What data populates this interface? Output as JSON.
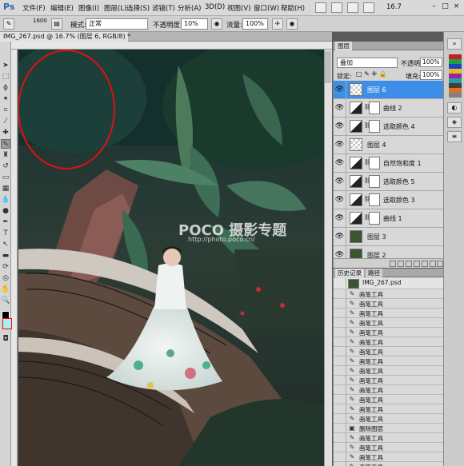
{
  "app": {
    "logo": "Ps"
  },
  "menu": [
    {
      "label": "文件(F)"
    },
    {
      "label": "编辑(E)"
    },
    {
      "label": "图像(I)"
    },
    {
      "label": "图层(L)"
    },
    {
      "label": "选择(S)"
    },
    {
      "label": "滤镜(T)"
    },
    {
      "label": "分析(A)"
    },
    {
      "label": "3D(D)"
    },
    {
      "label": "视图(V)"
    },
    {
      "label": "窗口(W)"
    },
    {
      "label": "帮助(H)"
    }
  ],
  "zoom": "16.7",
  "options": {
    "brush_size": "1600",
    "mode_label": "模式:",
    "mode_value": "正常",
    "opacity_label": "不透明度:",
    "opacity_value": "10%",
    "flow_label": "流量:",
    "flow_value": "100%"
  },
  "document": {
    "tab_title": "IMG_267.psd @ 16.7% (图层 6, RGB/8) *"
  },
  "canvas": {
    "watermark": "POCO 摄影专题",
    "watermark_url": "http://photo.poco.cn/"
  },
  "layers_panel": {
    "tabs": [
      "图层"
    ],
    "blend_mode": "叠加",
    "opacity_label": "不透明度:",
    "opacity_value": "100%",
    "lock_label": "锁定:",
    "fill_label": "填充:",
    "fill_value": "100%",
    "layers": [
      {
        "name": "图层 6",
        "type": "checker",
        "selected": true,
        "has_mask": false
      },
      {
        "name": "曲线 2",
        "type": "adj",
        "selected": false,
        "has_mask": true
      },
      {
        "name": "选取颜色 4",
        "type": "adj",
        "selected": false,
        "has_mask": true
      },
      {
        "name": "图层 4",
        "type": "checker",
        "selected": false,
        "has_mask": false
      },
      {
        "name": "自然饱和度 1",
        "type": "adj",
        "selected": false,
        "has_mask": true
      },
      {
        "name": "选取颜色 5",
        "type": "adj",
        "selected": false,
        "has_mask": true
      },
      {
        "name": "选取颜色 3",
        "type": "adj",
        "selected": false,
        "has_mask": true
      },
      {
        "name": "曲线 1",
        "type": "adj",
        "selected": false,
        "has_mask": true
      },
      {
        "name": "图层 3",
        "type": "photo",
        "selected": false,
        "has_mask": false
      },
      {
        "name": "图层 2",
        "type": "photo",
        "selected": false,
        "has_mask": false
      }
    ]
  },
  "history_panel": {
    "tabs": [
      "历史记录",
      "路径"
    ],
    "snapshot": "IMG_267.psd",
    "items": [
      {
        "label": "画笔工具",
        "icon": "brush-icon"
      },
      {
        "label": "画笔工具",
        "icon": "brush-icon"
      },
      {
        "label": "画笔工具",
        "icon": "brush-icon"
      },
      {
        "label": "画笔工具",
        "icon": "brush-icon"
      },
      {
        "label": "画笔工具",
        "icon": "brush-icon"
      },
      {
        "label": "画笔工具",
        "icon": "brush-icon"
      },
      {
        "label": "画笔工具",
        "icon": "brush-icon"
      },
      {
        "label": "画笔工具",
        "icon": "brush-icon"
      },
      {
        "label": "画笔工具",
        "icon": "brush-icon"
      },
      {
        "label": "画笔工具",
        "icon": "brush-icon"
      },
      {
        "label": "画笔工具",
        "icon": "brush-icon"
      },
      {
        "label": "画笔工具",
        "icon": "brush-icon"
      },
      {
        "label": "画笔工具",
        "icon": "brush-icon"
      },
      {
        "label": "画笔工具",
        "icon": "brush-icon"
      },
      {
        "label": "删除图层",
        "icon": "delete-layer-icon"
      },
      {
        "label": "画笔工具",
        "icon": "brush-icon"
      },
      {
        "label": "画笔工具",
        "icon": "brush-icon"
      },
      {
        "label": "画笔工具",
        "icon": "brush-icon"
      },
      {
        "label": "画笔工具",
        "icon": "brush-icon"
      },
      {
        "label": "画笔工具",
        "icon": "brush-icon"
      }
    ]
  },
  "colors": {
    "selection_blue": "#3c8ee8",
    "background_swatch": "#a5f0f5",
    "foreground_swatch": "#000000",
    "annotation_red": "#e01010"
  }
}
